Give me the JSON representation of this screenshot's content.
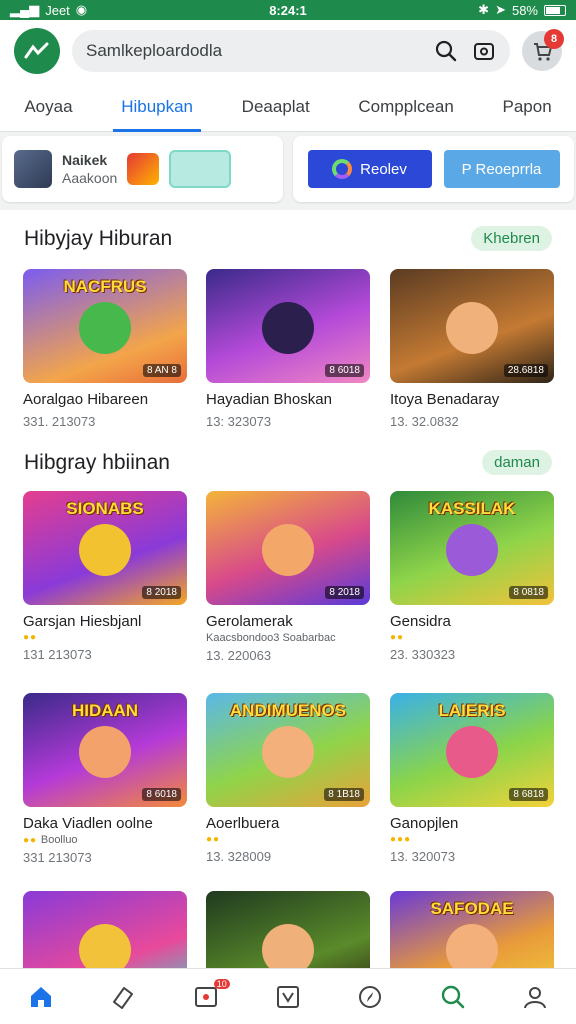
{
  "status_bar": {
    "carrier": "Jeet",
    "time": "8:24:1",
    "battery": "58%"
  },
  "header": {
    "search_value": "Samlkeploardodla",
    "notification_count": "8"
  },
  "tabs": [
    {
      "label": "Aoyaa",
      "active": false
    },
    {
      "label": "Hibupkan",
      "active": true
    },
    {
      "label": "Deaaplat",
      "active": false
    },
    {
      "label": "Compplcean",
      "active": false
    },
    {
      "label": "Papon",
      "active": false
    }
  ],
  "promo": {
    "title": "Naikek",
    "subtitle": "Aaakoon",
    "button_primary": "Reolev",
    "button_secondary": "P Reoeprrla"
  },
  "sections": [
    {
      "title": "Hibyjay Hiburan",
      "chip": "Khebren",
      "cards": [
        {
          "title": "Aoralgao Hibareen",
          "meta": "331. 213073",
          "headline": "NACFRUS",
          "badge": "8 AN 8"
        },
        {
          "title": "Hayadian Bhoskan",
          "meta": "13: 323073",
          "headline": "",
          "badge": "8 6018"
        },
        {
          "title": "Itoya Benadaray",
          "meta": "13. 32.0832",
          "headline": "",
          "badge": "28.6818"
        }
      ]
    },
    {
      "title": "Hibgray hbiinan",
      "chip": "daman",
      "cards": [
        {
          "title": "Garsjan Hiesbjanl",
          "meta": "131 213073",
          "headline": "SIONABS",
          "badge": "8 2018"
        },
        {
          "title": "Gerolamerak",
          "subtitle": "Kaacsbondoo3 Soabarbac",
          "meta": "13. 220063",
          "headline": "",
          "badge": "8 2018"
        },
        {
          "title": "Gensidra",
          "meta": "23. 330323",
          "headline": "KASSILAK",
          "badge": "8 0818"
        }
      ]
    },
    {
      "cards": [
        {
          "title": "Daka Viadlen oolne",
          "subtitle": "Boolluo",
          "meta": "331 213073",
          "headline": "HIDAAN",
          "badge": "8 6018"
        },
        {
          "title": "Aoerlbuera",
          "meta": "13. 328009",
          "headline": "ANDIMUENOS",
          "badge": "8 1B18"
        },
        {
          "title": "Ganopjlen",
          "meta": "13. 320073",
          "headline": "LAIERIS",
          "badge": "8 6818"
        }
      ]
    },
    {
      "cards": [
        {
          "headline": ""
        },
        {
          "headline": ""
        },
        {
          "headline": "SAFODAE"
        }
      ]
    }
  ],
  "bottom_nav": [
    {
      "name": "home",
      "badge": ""
    },
    {
      "name": "tag",
      "badge": ""
    },
    {
      "name": "inbox",
      "badge": "10"
    },
    {
      "name": "check",
      "badge": ""
    },
    {
      "name": "compass",
      "badge": ""
    },
    {
      "name": "search",
      "badge": ""
    },
    {
      "name": "profile",
      "badge": ""
    }
  ],
  "colors": {
    "brand": "#1e8a4c",
    "accent": "#1a73e8",
    "chip_bg": "#dff3e5"
  }
}
